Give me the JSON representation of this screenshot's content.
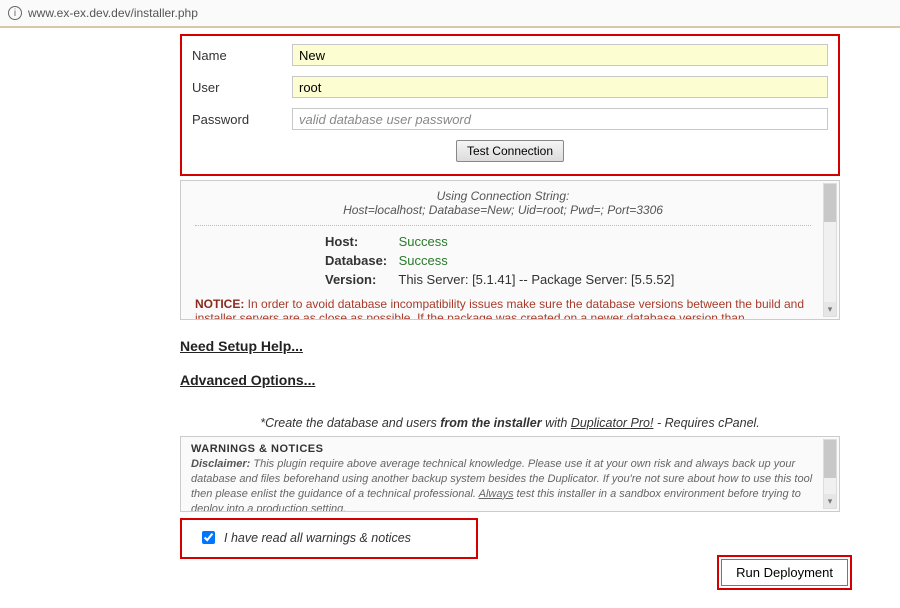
{
  "browser": {
    "url": "www.ex-ex.dev.dev/installer.php"
  },
  "form": {
    "name_label": "Name",
    "name_value": "New",
    "user_label": "User",
    "user_value": "root",
    "password_label": "Password",
    "password_placeholder": "valid database user password",
    "test_button": "Test Connection"
  },
  "conn": {
    "using": "Using Connection String:",
    "string": "Host=localhost; Database=New; Uid=root; Pwd=; Port=3306"
  },
  "results": {
    "host_label": "Host:",
    "host_status": "Success",
    "db_label": "Database:",
    "db_status": "Success",
    "ver_label": "Version:",
    "ver_text": "This Server: [5.1.41] -- Package Server: [5.5.52]"
  },
  "notice": {
    "label": "NOTICE:",
    "text": " In order to avoid database incompatibility issues make sure the database versions between the build and installer servers are as close as possible. If the package was created on a newer database version than"
  },
  "links": {
    "setup": "Need Setup Help...",
    "advanced": "Advanced Options..."
  },
  "create_note": {
    "pre": "*Create the database and users ",
    "bold": "from the installer",
    "mid": " with ",
    "pro": "Duplicator Pro!",
    "post": " - Requires cPanel."
  },
  "warnings": {
    "title": "WARNINGS & NOTICES",
    "disclaimer_label": "Disclaimer:",
    "disclaimer_text": " This plugin require above average technical knowledge. Please use it at your own risk and always back up your database and files beforehand using another backup system besides the Duplicator. If you're not sure about how to use this tool then please enlist the guidance of a technical professional. ",
    "always": "Always",
    "disclaimer_tail": " test this installer in a sandbox environment before trying to deploy into a production setting."
  },
  "agree": {
    "label": "I have read all warnings & notices"
  },
  "run": {
    "label": "Run Deployment"
  }
}
